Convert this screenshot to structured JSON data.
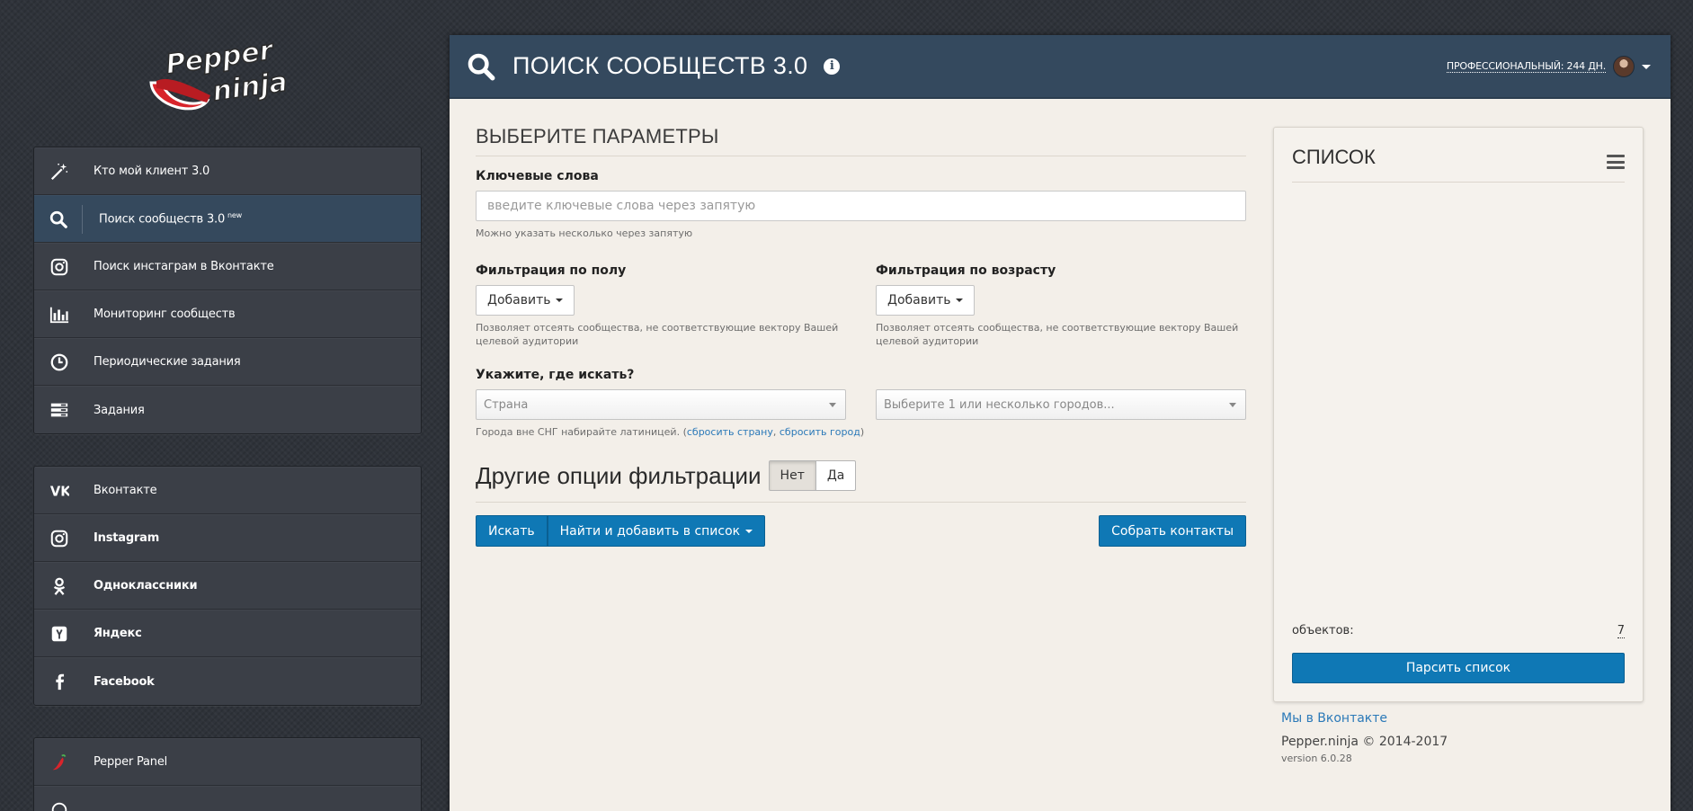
{
  "brand": {
    "logo_line1": "Pepper",
    "logo_line2": "ninja"
  },
  "sidebar": {
    "group1": [
      {
        "icon": "magic-wand-icon",
        "label": "Кто мой клиент 3.0",
        "badge": ""
      },
      {
        "icon": "search-icon",
        "label": "Поиск сообществ 3.0",
        "badge": "new",
        "active": true
      },
      {
        "icon": "instagram-icon",
        "label": "Поиск инстаграм в Вконтакте",
        "badge": ""
      },
      {
        "icon": "bar-chart-icon",
        "label": "Мониторинг сообществ",
        "badge": ""
      },
      {
        "icon": "clock-icon",
        "label": "Периодические задания",
        "badge": ""
      },
      {
        "icon": "tasks-list-icon",
        "label": "Задания",
        "badge": ""
      }
    ],
    "group2": [
      {
        "icon": "vk-icon",
        "label": "Вконтакте"
      },
      {
        "icon": "instagram-icon",
        "label": "Instagram"
      },
      {
        "icon": "odnoklassniki-icon",
        "label": "Одноклассники"
      },
      {
        "icon": "yandex-icon",
        "label": "Яндекс"
      },
      {
        "icon": "facebook-icon",
        "label": "Facebook"
      }
    ],
    "group3": [
      {
        "icon": "pepper-icon",
        "label": "Pepper Panel"
      }
    ]
  },
  "header": {
    "title": "ПОИСК СООБЩЕСТВ 3.0",
    "info_glyph": "i",
    "plan": "ПРОФЕССИОНАЛЬНЫЙ: 244 ДН."
  },
  "form": {
    "section_title": "ВЫБЕРИТЕ ПАРАМЕТРЫ",
    "keywords_label": "Ключевые слова",
    "keywords_placeholder": "введите ключевые слова через запятую",
    "keywords_help": "Можно указать несколько через запятую",
    "gender_label": "Фильтрация по полу",
    "gender_button": "Добавить",
    "gender_help": "Позволяет отсеять сообщества, не соответствующие вектору Вашей целевой аудитории",
    "age_label": "Фильтрация по возрасту",
    "age_button": "Добавить",
    "age_help": "Позволяет отсеять сообщества, не соответствующие вектору Вашей целевой аудитории",
    "where_label": "Укажите, где искать?",
    "country_placeholder": "Страна",
    "city_placeholder": "Выберите 1 или несколько городов...",
    "where_help_prefix": "Города вне СНГ набирайте латиницей. (",
    "reset_country": "сбросить страну",
    "comma": ", ",
    "reset_city": "сбросить город",
    "where_help_suffix": ")",
    "other_title": "Другие опции фильтрации",
    "toggle_no": "Нет",
    "toggle_yes": "Да",
    "search_button": "Искать",
    "find_add_button": "Найти и добавить в список",
    "collect_button": "Собрать контакты"
  },
  "list_panel": {
    "title": "СПИСОК",
    "objects_label": "объектов:",
    "objects_count": "7",
    "parse_button": "Парсить список"
  },
  "footer": {
    "vk_link": "Мы в Вконтакте",
    "copyright": "Pepper.ninja © 2014-2017",
    "version": "version 6.0.28"
  },
  "colors": {
    "header_bg": "#34495e",
    "primary": "#0f78b5",
    "sidebar_bg": "#3b3f47",
    "active_item": "#35495d",
    "content_bg": "#f3efe9"
  }
}
